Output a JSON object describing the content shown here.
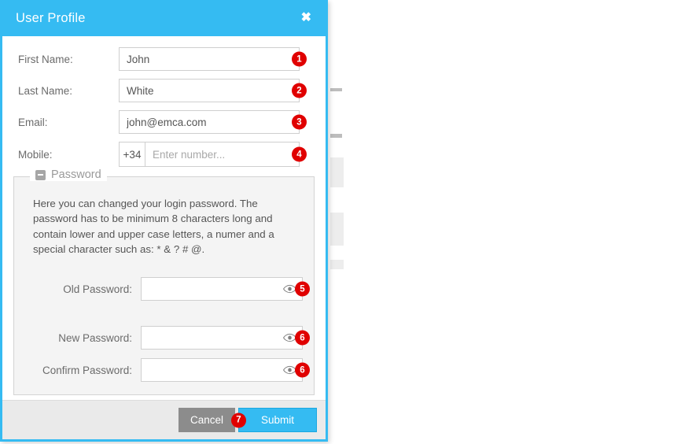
{
  "dialog": {
    "title": "User Profile",
    "close_icon": "close-icon"
  },
  "form": {
    "fields": [
      {
        "label": "First Name:",
        "value": "John",
        "placeholder": "",
        "badge": "1"
      },
      {
        "label": "Last Name:",
        "value": "White",
        "placeholder": "",
        "badge": "2"
      },
      {
        "label": "Email:",
        "value": "john@emca.com",
        "placeholder": "",
        "badge": "3"
      }
    ],
    "mobile": {
      "label": "Mobile:",
      "country_code": "+34",
      "value": "",
      "placeholder": "Enter number...",
      "badge": "4"
    }
  },
  "password_section": {
    "legend": "Password",
    "collapse_icon": "minus-square-icon",
    "description": "Here you can changed your login password. The password has to be minimum 8 characters long and contain lower and upper case letters, a numer and a special character such as: * & ? # @.",
    "fields": [
      {
        "label": "Old Password:",
        "value": "",
        "badge": "5",
        "reveal_icon": "eye-icon"
      },
      {
        "label": "New Password:",
        "value": "",
        "badge": "6",
        "reveal_icon": "eye-icon"
      },
      {
        "label": "Confirm Password:",
        "value": "",
        "badge": "6",
        "reveal_icon": "eye-icon"
      }
    ]
  },
  "footer": {
    "cancel_label": "Cancel",
    "submit_label": "Submit",
    "submit_badge": "7"
  },
  "colors": {
    "accent": "#35bbf2",
    "badge": "#e00000",
    "cancel": "#8c8c8c",
    "footer_bg": "#eaeaea",
    "fieldset_bg": "#f4f4f4"
  }
}
